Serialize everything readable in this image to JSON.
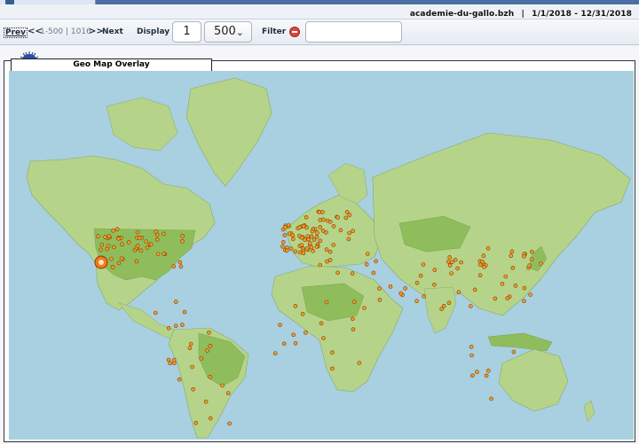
{
  "header": {
    "site": "academie-du-gallo.bzh",
    "separator": "|",
    "date_range": "1/1/2018 - 12/31/2018"
  },
  "pager": {
    "prev_label": "Prev",
    "prev_chevron": "<<",
    "range_label": "1-500 | 1016",
    "next_chevron": ">>",
    "next_label": "Next",
    "display_label": "Display",
    "page_value": "1",
    "per_page_value": "500",
    "filter_label": "Filter",
    "filter_value": ""
  },
  "panel": {
    "title": "Geo Map Overlay"
  },
  "map": {
    "land_color": "#b5d48a",
    "land_dark": "#8fbd5c",
    "ocean_color": "#a8d0e0",
    "marker_color": "#f29b2b",
    "highlight_marker_color": "#f07a1a"
  }
}
